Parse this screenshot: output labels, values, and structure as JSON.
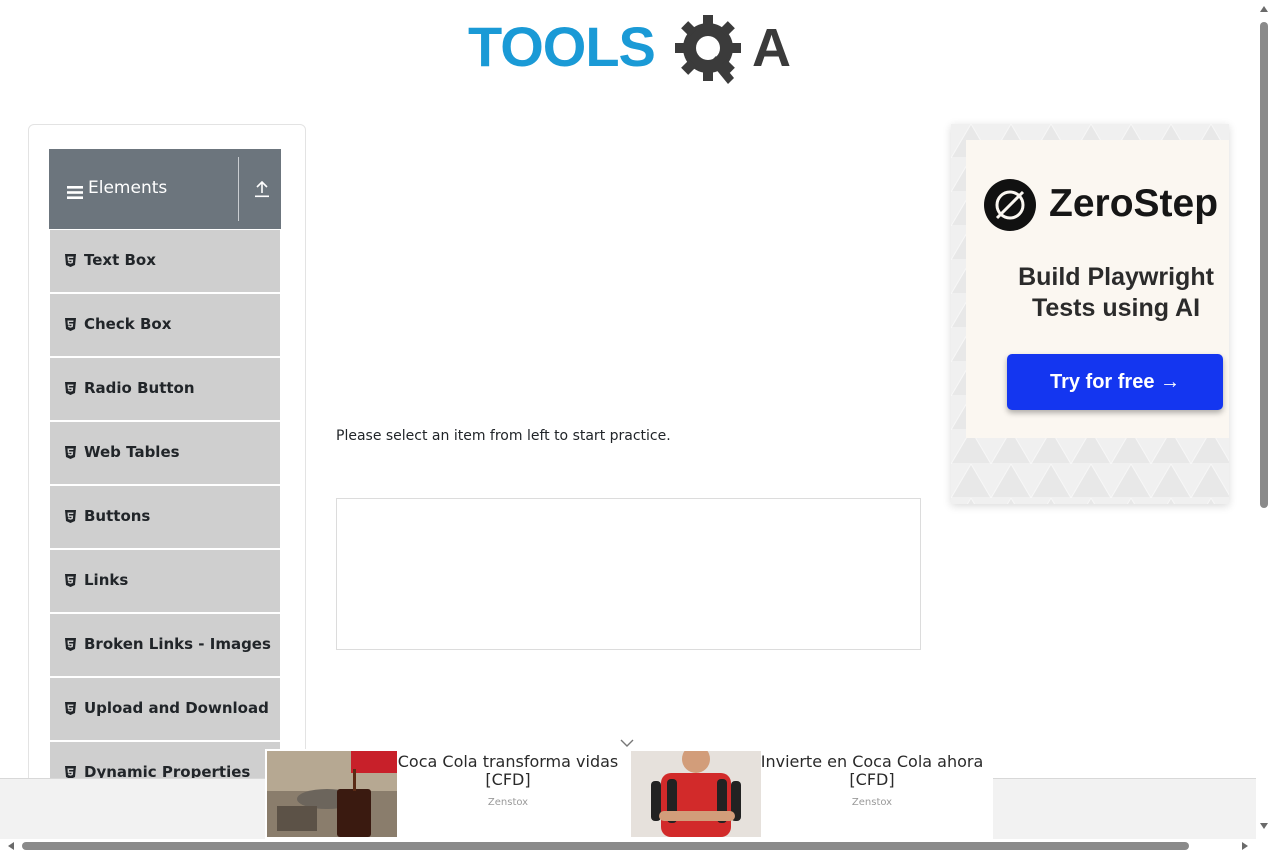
{
  "logo": {
    "text_left": "TOOLS",
    "text_right": "A",
    "alt": "TOOLSQA"
  },
  "sidebar": {
    "group_title": "Elements",
    "items": [
      {
        "label": "Text Box"
      },
      {
        "label": "Check Box"
      },
      {
        "label": "Radio Button"
      },
      {
        "label": "Web Tables"
      },
      {
        "label": "Buttons"
      },
      {
        "label": "Links"
      },
      {
        "label": "Broken Links - Images"
      },
      {
        "label": "Upload and Download"
      },
      {
        "label": "Dynamic Properties"
      }
    ]
  },
  "main": {
    "instruction": "Please select an item from left to start practice."
  },
  "ad_right": {
    "brand": "ZeroStep",
    "tagline_line1": "Build Playwright",
    "tagline_line2": "Tests using AI",
    "cta": "Try for free →"
  },
  "bottom_ads": [
    {
      "title": "Coca Cola transforma vidas [CFD]",
      "source": "Zenstox"
    },
    {
      "title": "Invierte en Coca Cola ahora [CFD]",
      "source": "Zenstox"
    }
  ],
  "colors": {
    "logo_blue": "#1a9ad6",
    "logo_dark": "#3b3b3b",
    "sidebar_header": "#6c757d",
    "menu_item_bg": "#cfcfcf",
    "cta_blue": "#1436f0"
  }
}
